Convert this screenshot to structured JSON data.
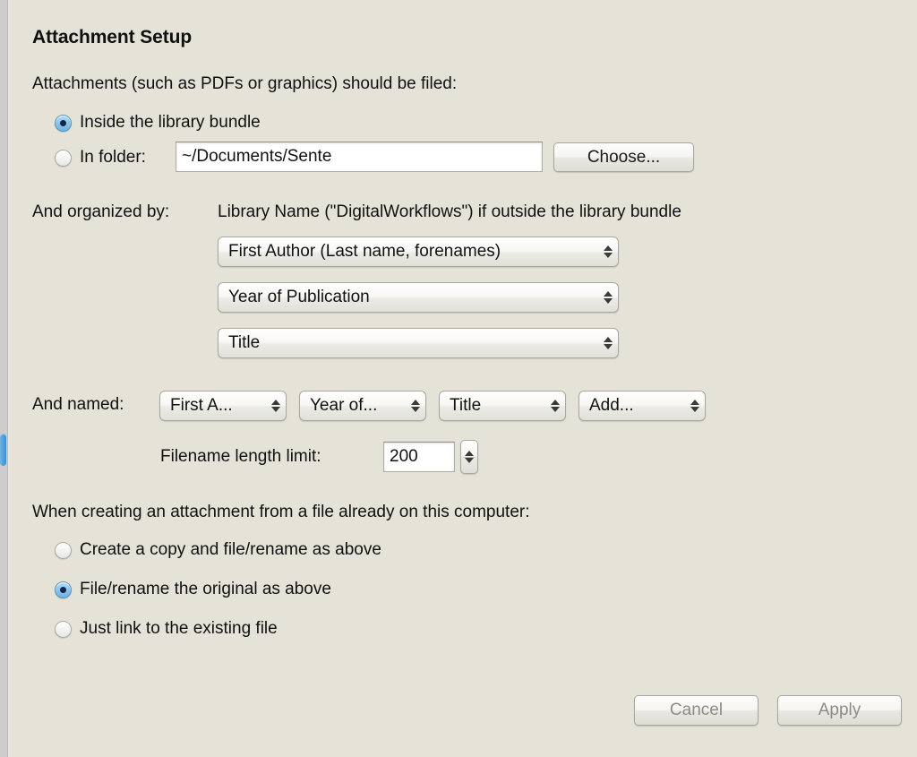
{
  "panel": {
    "title": "Attachment Setup"
  },
  "filing": {
    "prompt": "Attachments (such as PDFs or graphics) should be filed:",
    "options": [
      {
        "label": "Inside the library bundle",
        "selected": true
      },
      {
        "label": "In folder:",
        "selected": false
      }
    ],
    "folder_value": "~/Documents/Sente",
    "choose_label": "Choose..."
  },
  "organized": {
    "label": "And organized by:",
    "note": "Library Name (\"DigitalWorkflows\") if outside the library bundle",
    "popups": [
      {
        "value": "First Author (Last name, forenames)"
      },
      {
        "value": "Year of Publication"
      },
      {
        "value": "Title"
      }
    ]
  },
  "named": {
    "label": "And named:",
    "popups": [
      {
        "value": "First A..."
      },
      {
        "value": "Year of..."
      },
      {
        "value": "Title"
      },
      {
        "value": "Add..."
      }
    ]
  },
  "filename_limit": {
    "label": "Filename length limit:",
    "value": "200"
  },
  "existing_file": {
    "prompt": "When creating an attachment from a file already on this computer:",
    "options": [
      {
        "label": "Create a copy and file/rename as above",
        "selected": false
      },
      {
        "label": "File/rename the original as above",
        "selected": true
      },
      {
        "label": "Just link to the existing file",
        "selected": false
      }
    ]
  },
  "footer": {
    "cancel_label": "Cancel",
    "apply_label": "Apply"
  },
  "colors": {
    "background": "#e5e3d7",
    "accent_blue": "#4e9fdd",
    "radio_dot": "#10264a",
    "disabled_text": "#8d8d88"
  }
}
